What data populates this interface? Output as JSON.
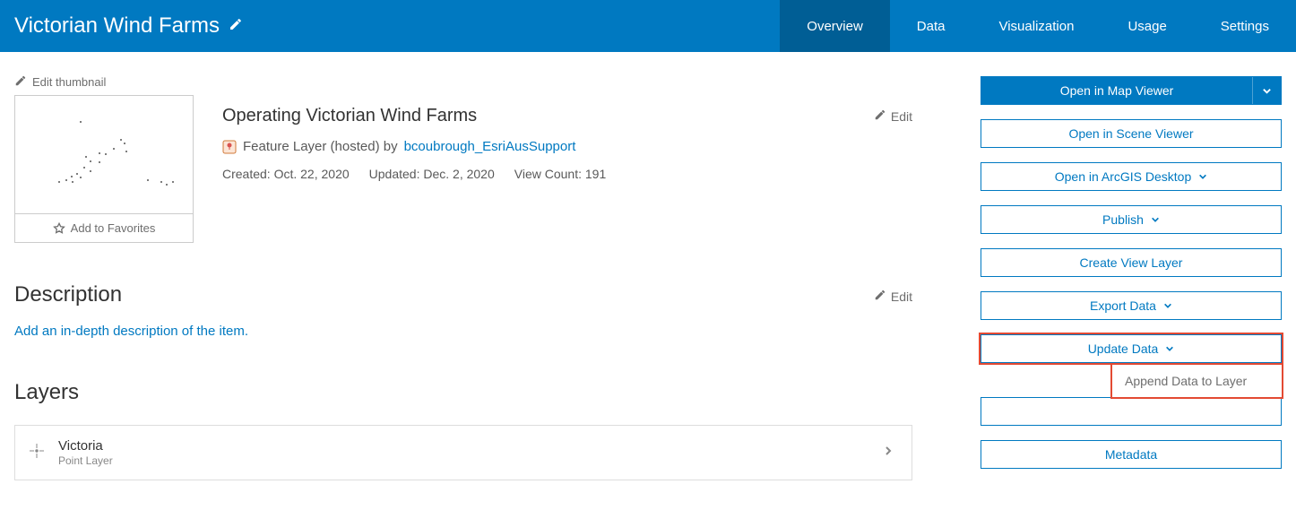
{
  "header": {
    "title": "Victorian Wind Farms",
    "tabs": [
      "Overview",
      "Data",
      "Visualization",
      "Usage",
      "Settings"
    ],
    "active_tab": 0
  },
  "thumbnail": {
    "edit_label": "Edit thumbnail",
    "favorites_label": "Add to Favorites"
  },
  "item": {
    "title": "Operating Victorian Wind Farms",
    "edit_label": "Edit",
    "type_label": "Feature Layer (hosted) by ",
    "author": "bcoubrough_EsriAusSupport",
    "created": "Created: Oct. 22, 2020",
    "updated": "Updated: Dec. 2, 2020",
    "views": "View Count: 191"
  },
  "description": {
    "heading": "Description",
    "edit_label": "Edit",
    "placeholder": "Add an in-depth description of the item."
  },
  "layers": {
    "heading": "Layers",
    "items": [
      {
        "name": "Victoria",
        "type": "Point Layer"
      }
    ]
  },
  "actions": {
    "open_map_viewer": "Open in Map Viewer",
    "open_scene_viewer": "Open in Scene Viewer",
    "open_desktop": "Open in ArcGIS Desktop",
    "publish": "Publish",
    "create_view": "Create View Layer",
    "export_data": "Export Data",
    "update_data": "Update Data",
    "append_data": "Append Data to Layer",
    "metadata": "Metadata"
  }
}
